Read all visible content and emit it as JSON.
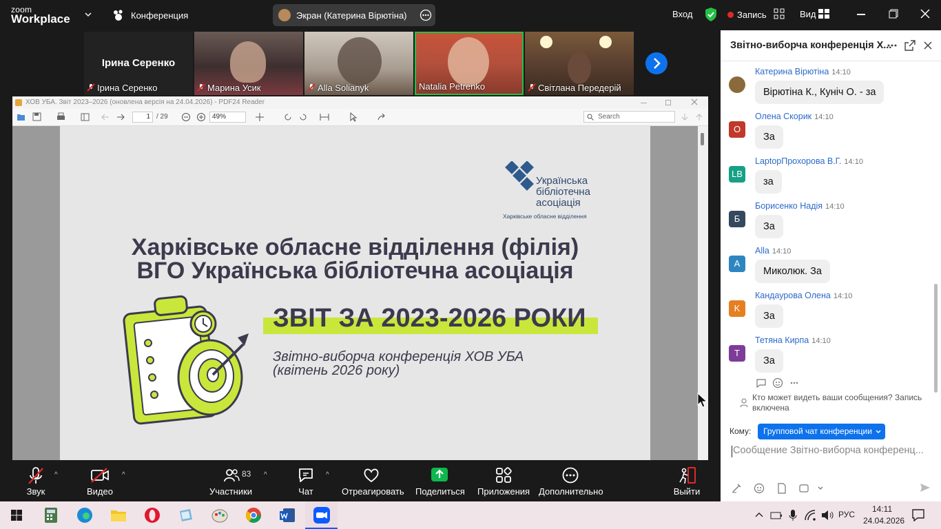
{
  "app": {
    "brand_small": "zoom",
    "brand_big": "Workplace"
  },
  "topbar": {
    "meeting_label": "Конференция",
    "share_label": "Экран (Катерина Вірютіна)",
    "login_label": "Вход",
    "record_label": "Запись",
    "view_label": "Вид"
  },
  "gallery": {
    "tiles": [
      {
        "name": "Ірина Серенко",
        "center_name": "Ірина Серенко"
      },
      {
        "name": "Марина Усик"
      },
      {
        "name": "Alla Solianyk"
      },
      {
        "name": "Natalia Petrenko"
      },
      {
        "name": "Світлана Передерій"
      }
    ]
  },
  "pdf": {
    "title": "ХОВ УБА. Звіт 2023–2026 (оновлена версія на 24.04.2026) - PDF24 Reader",
    "page_current": "1",
    "page_total": "/ 29",
    "zoom": "49%",
    "search_placeholder": "Search",
    "logo_line1": "Українська",
    "logo_line2": "бібліотечна",
    "logo_line3": "асоціація",
    "logo_sub": "Харківське обласне відділення",
    "title_line1": "Харківське обласне відділення (філія)",
    "title_line2": "ВГО Українська бібліотечна асоціація",
    "report_title": "ЗВІТ ЗА 2023-2026 РОКИ",
    "subtitle_line1": "Звітно-виборча конференція ХОВ УБА",
    "subtitle_line2": "(квітень 2026 року)"
  },
  "chat": {
    "title": "Звітно-виборча конференція Х...",
    "messages": [
      {
        "sender": "Катерина Вірютіна",
        "time": "14:10",
        "text": "Вірютіна К., Кунiч О. - за",
        "avatar": "",
        "color": "#8a6a3a"
      },
      {
        "sender": "Олена Скорик",
        "time": "14:10",
        "text": "За",
        "avatar": "О",
        "color": "#c0392b"
      },
      {
        "sender": "LaptopПрохорова В.Г.",
        "time": "14:10",
        "text": "за",
        "avatar": "LB",
        "color": "#16a085"
      },
      {
        "sender": "Борисенко Надія",
        "time": "14:10",
        "text": "За",
        "avatar": "Б",
        "color": "#34495e"
      },
      {
        "sender": "Alla",
        "time": "14:10",
        "text": "Миколюк. За",
        "avatar": "A",
        "color": "#2e86c1"
      },
      {
        "sender": "Кандаурова Олена",
        "time": "14:10",
        "text": "За",
        "avatar": "K",
        "color": "#e67e22"
      },
      {
        "sender": "Тетяна Кирпа",
        "time": "14:10",
        "text": "За",
        "avatar": "T",
        "color": "#7d3c98"
      }
    ],
    "visibility_note": "Кто может видеть ваши сообщения? Запись включена",
    "to_label": "Кому:",
    "to_value": "Групповой чат конференции",
    "input_placeholder": "Сообщение Звітно-виборча конференц..."
  },
  "toolbar": {
    "audio": "Звук",
    "video": "Видео",
    "participants": "Участники",
    "participants_count": "83",
    "chat": "Чат",
    "react": "Отреагировать",
    "share": "Поделиться",
    "apps": "Приложения",
    "more": "Дополнительно",
    "leave": "Выйти"
  },
  "taskbar": {
    "lang": "РУС",
    "time": "14:11",
    "date": "24.04.2026"
  },
  "colors": {
    "accent": "#0e72ed",
    "share_green": "#0fb84c",
    "lime": "#c9e63b",
    "record_red": "#e02828"
  }
}
